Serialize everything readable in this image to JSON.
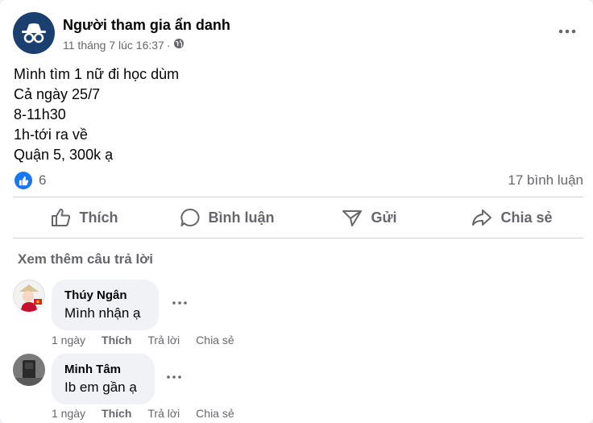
{
  "post": {
    "author": "Người tham gia ẩn danh",
    "time": "11 tháng 7 lúc 16:37",
    "meta_dot": "·",
    "body_lines": [
      "Mình tìm 1 nữ đi học dùm",
      "Cả ngày 25/7",
      "8-11h30",
      "1h-tới ra về",
      "Quận 5, 300k ạ"
    ],
    "reaction_count": "6",
    "comment_count": "17 bình luận"
  },
  "actions": {
    "like": "Thích",
    "comment": "Bình luận",
    "send": "Gửi",
    "share": "Chia sẻ"
  },
  "more_replies": "Xem thêm câu trả lời",
  "comments": [
    {
      "name": "Thúy Ngân",
      "text": "Mình nhận ạ",
      "time": "1 ngày",
      "like": "Thích",
      "reply": "Trả lời",
      "share": "Chia sẻ"
    },
    {
      "name": "Minh Tâm",
      "text": "Ib em gần ạ",
      "time": "1 ngày",
      "like": "Thích",
      "reply": "Trả lời",
      "share": "Chia sẻ"
    }
  ],
  "icons": {
    "avatar": "anonymous-icon",
    "privacy": "globe-icon",
    "more": "more-dots-icon",
    "like_badge": "thumbs-up-icon"
  },
  "colors": {
    "brand_blue": "#1877f2",
    "muted_text": "#65676b",
    "bubble_bg": "#f0f2f5",
    "anon_avatar_bg": "#1b3f6e"
  }
}
